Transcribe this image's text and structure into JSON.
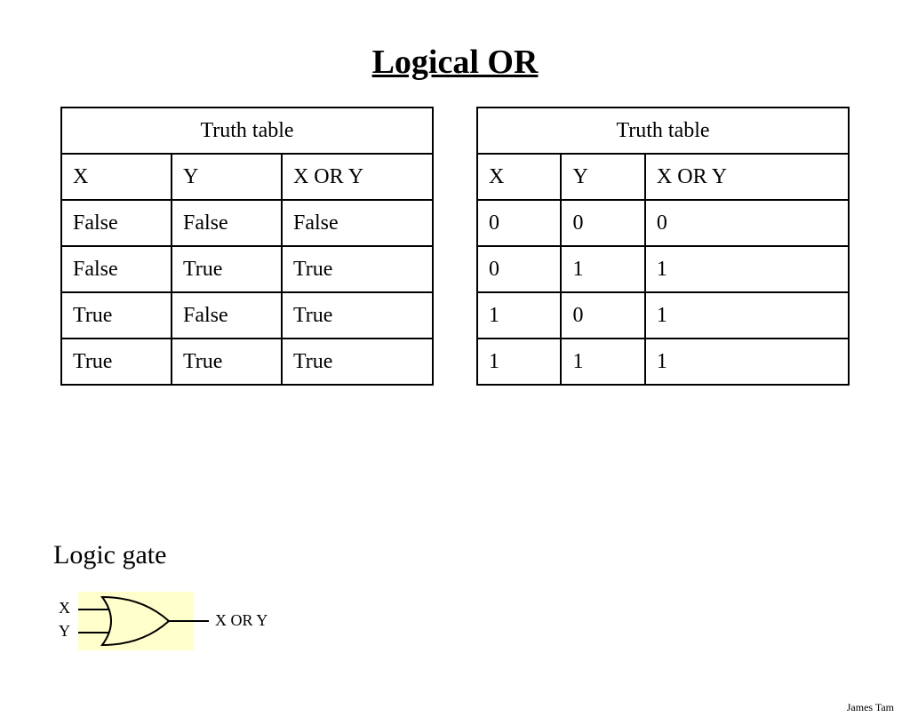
{
  "title": "Logical OR",
  "author": "James Tam",
  "gate_section_label": "Logic gate",
  "gate": {
    "input1": "X",
    "input2": "Y",
    "output": "X OR Y"
  },
  "table_left": {
    "caption": "Truth table",
    "headers": [
      "X",
      "Y",
      "X OR Y"
    ],
    "rows": [
      [
        "False",
        "False",
        "False"
      ],
      [
        "False",
        "True",
        "True"
      ],
      [
        "True",
        "False",
        "True"
      ],
      [
        "True",
        "True",
        "True"
      ]
    ]
  },
  "table_right": {
    "caption": "Truth table",
    "headers": [
      "X",
      "Y",
      "X OR Y"
    ],
    "rows": [
      [
        "0",
        "0",
        "0"
      ],
      [
        "0",
        "1",
        "1"
      ],
      [
        "1",
        "0",
        "1"
      ],
      [
        "1",
        "1",
        "1"
      ]
    ]
  },
  "chart_data": [
    {
      "type": "table",
      "title": "Truth table",
      "columns": [
        "X",
        "Y",
        "X OR Y"
      ],
      "rows": [
        [
          "False",
          "False",
          "False"
        ],
        [
          "False",
          "True",
          "True"
        ],
        [
          "True",
          "False",
          "True"
        ],
        [
          "True",
          "True",
          "True"
        ]
      ]
    },
    {
      "type": "table",
      "title": "Truth table",
      "columns": [
        "X",
        "Y",
        "X OR Y"
      ],
      "rows": [
        [
          "0",
          "0",
          "0"
        ],
        [
          "0",
          "1",
          "1"
        ],
        [
          "1",
          "0",
          "1"
        ],
        [
          "1",
          "1",
          "1"
        ]
      ]
    }
  ]
}
